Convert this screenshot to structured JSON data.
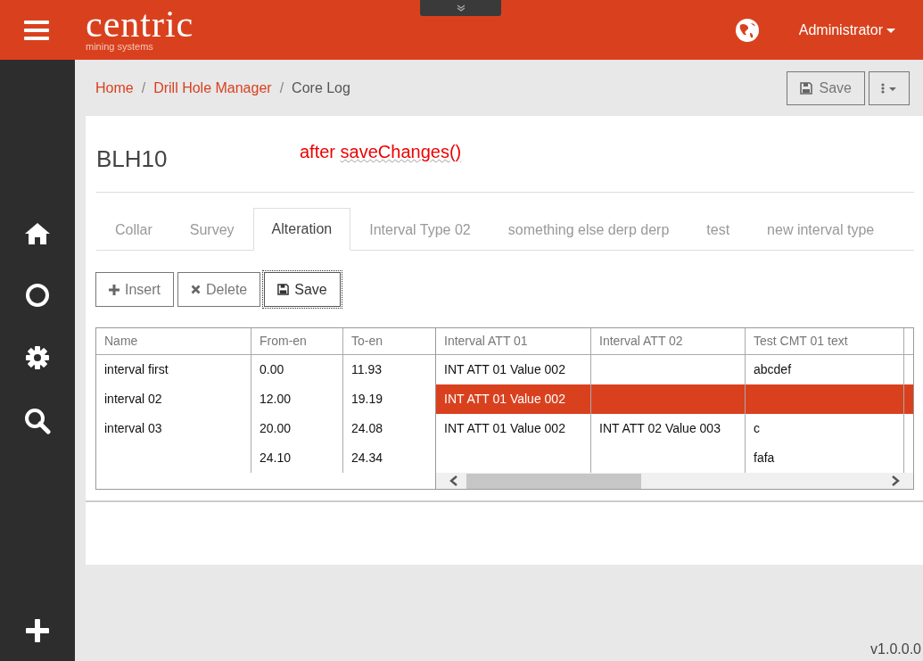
{
  "header": {
    "logo": "centric",
    "logo_subtitle": "mining systems",
    "user_menu": "Administrator"
  },
  "sidebar": {
    "items": [
      {
        "kind": "home"
      },
      {
        "kind": "circle"
      },
      {
        "kind": "gear"
      },
      {
        "kind": "search"
      }
    ],
    "bottom": {
      "kind": "plus"
    }
  },
  "breadcrumb": [
    {
      "label": "Home",
      "link": true
    },
    {
      "separator": "/",
      "label": "Drill Hole Manager",
      "link": true
    },
    {
      "separator": "/",
      "label": "Core Log",
      "link": false
    }
  ],
  "toolbar": {
    "save": "Save"
  },
  "record": {
    "title": "BLH10",
    "annotation": {
      "prefix": "after",
      "code": "saveChanges()"
    }
  },
  "tabs": [
    {
      "label": "Collar",
      "selected": false
    },
    {
      "label": "Survey",
      "selected": false
    },
    {
      "label": "Alteration",
      "selected": true
    },
    {
      "label": "Interval Type 02",
      "selected": false
    },
    {
      "label": "something else derp derp",
      "selected": false
    },
    {
      "label": "test",
      "selected": false
    },
    {
      "label": "new interval type",
      "selected": false
    }
  ],
  "actions": [
    {
      "kind": "insert",
      "label": "Insert",
      "focused": false
    },
    {
      "kind": "delete",
      "label": "Delete",
      "focused": false
    },
    {
      "kind": "save",
      "label": "Save",
      "focused": true
    }
  ],
  "table": {
    "frozen_columns": [
      "Name",
      "From-en",
      "To-en"
    ],
    "columns": [
      "Interval ATT 01",
      "Interval ATT 02",
      "Test CMT 01 text"
    ],
    "rows": [
      {
        "name": "interval first",
        "from": "0.00",
        "to": "11.93",
        "cells": [
          "INT ATT 01 Value 002",
          null,
          "abcdef"
        ],
        "selected": false
      },
      {
        "name": "interval 02",
        "from": "12.00",
        "to": "19.19",
        "cells": [
          "INT ATT 01 Value 002",
          null,
          null
        ],
        "selected": true
      },
      {
        "name": "interval 03",
        "from": "20.00",
        "to": "24.08",
        "cells": [
          "INT ATT 01 Value 002",
          "INT ATT 02 Value 003",
          "c"
        ],
        "selected": false
      },
      {
        "from": "24.10",
        "to": "24.34",
        "cells": [
          null,
          null,
          "fafa"
        ],
        "selected": false
      }
    ]
  },
  "version": "v1.0.0.0"
}
